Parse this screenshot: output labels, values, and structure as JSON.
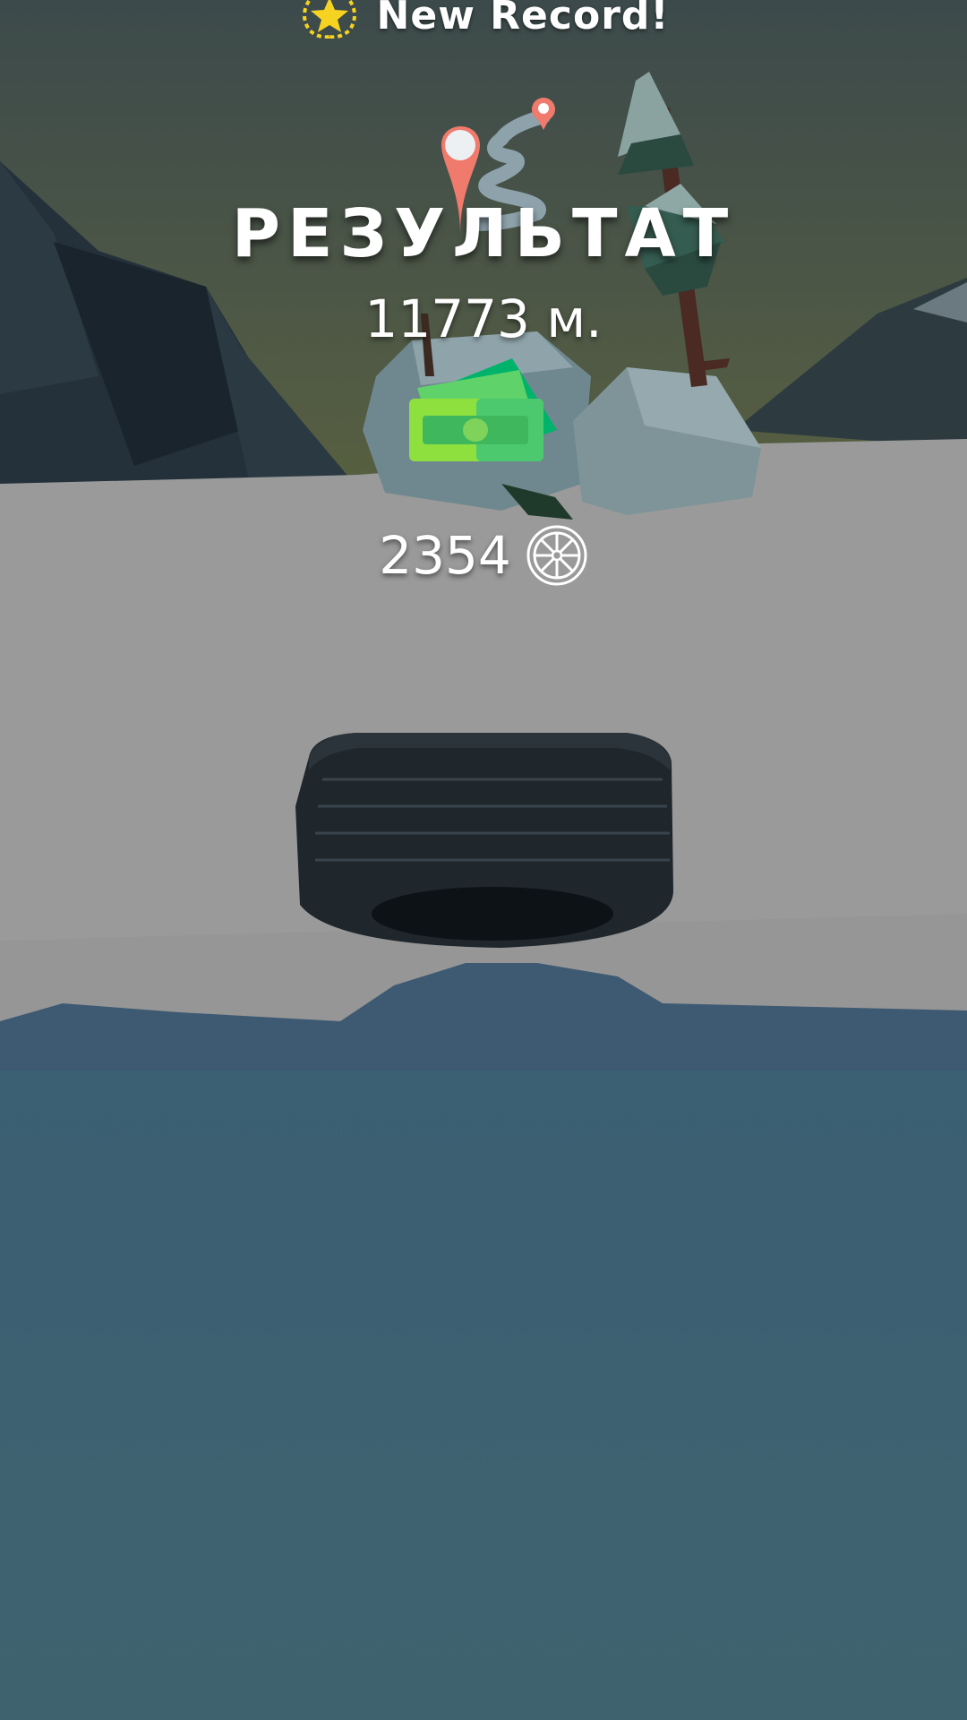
{
  "banner": {
    "text": "New Record!",
    "icon": "star-laurel-icon"
  },
  "result": {
    "title": "РЕЗУЛЬТАТ",
    "distance": "11773 м.",
    "route_icon": "route-pin-icon",
    "money_icon": "cash-icon"
  },
  "reward": {
    "coins": "2354",
    "icon": "wheel-coin-icon"
  },
  "colors": {
    "sky": "#4a5548",
    "snow": "#9a9a9a",
    "water": "#3e6070",
    "pin": "#f07a6c",
    "cash": "#3dc35f",
    "star": "#f5d320"
  }
}
